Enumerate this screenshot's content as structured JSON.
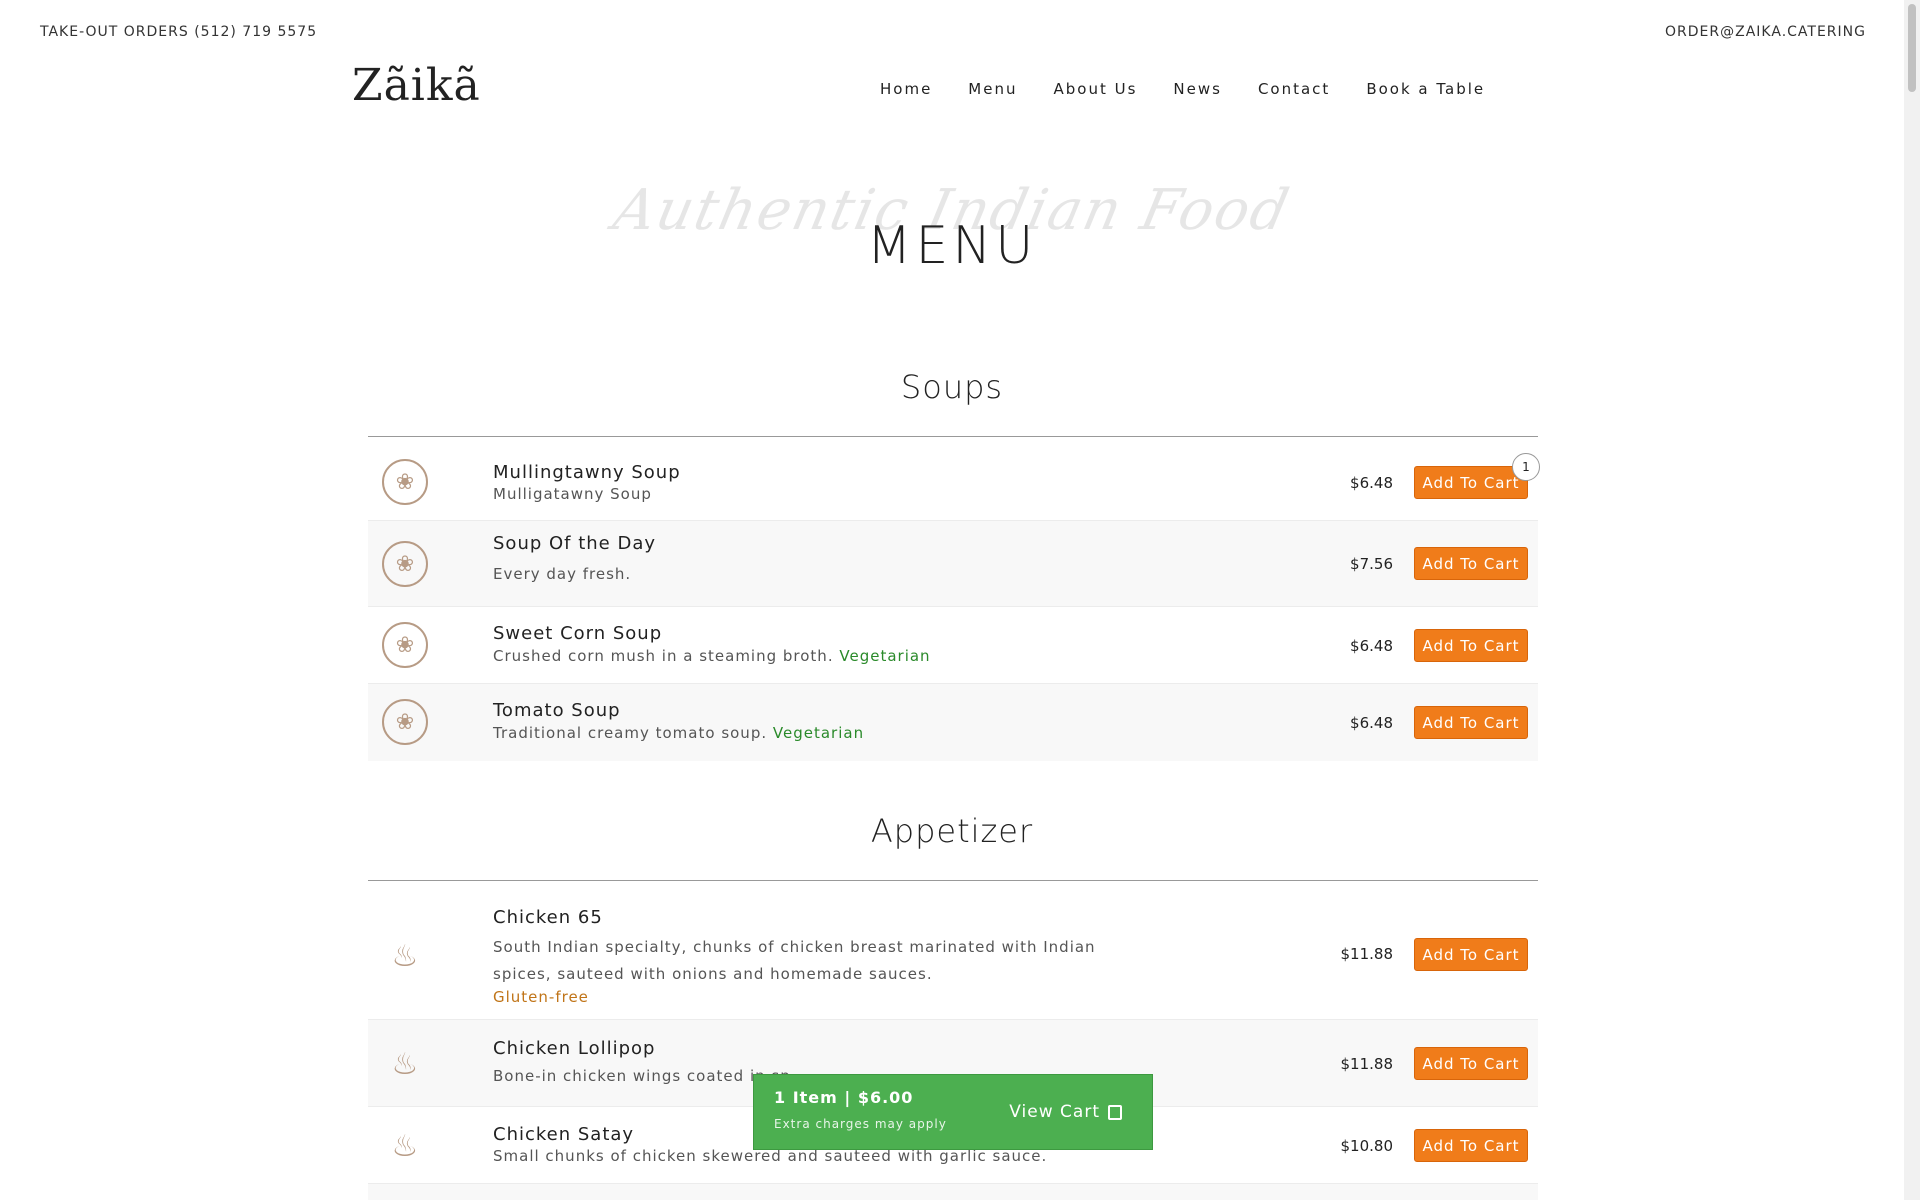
{
  "topbar": {
    "phone": "TAKE-OUT ORDERS (512) 719 5575",
    "email": "ORDER@ZAIKA.CATERING"
  },
  "logo": "Zãikã",
  "nav": {
    "home": "Home",
    "menu": "Menu",
    "about": "About Us",
    "news": "News",
    "contact": "Contact",
    "book": "Book a Table"
  },
  "hero": {
    "script": "Authentic Indian Food",
    "title": "MENU"
  },
  "sections": {
    "soups": {
      "title": "Soups",
      "items": [
        {
          "name": "Mullingtawny Soup",
          "desc": "Mulligatawny Soup",
          "tag": "",
          "price": "$6.48",
          "button": "Add To Cart",
          "qty": "1"
        },
        {
          "name": "Soup Of the Day",
          "desc": "Every day fresh.",
          "tag": "",
          "price": "$7.56",
          "button": "Add To Cart"
        },
        {
          "name": "Sweet Corn Soup",
          "desc": "Crushed corn mush in a steaming broth.",
          "tag": "Vegetarian",
          "price": "$6.48",
          "button": "Add To Cart"
        },
        {
          "name": "Tomato Soup",
          "desc": "Traditional creamy tomato soup.",
          "tag": "Vegetarian",
          "price": "$6.48",
          "button": "Add To Cart"
        }
      ]
    },
    "appetizer": {
      "title": "Appetizer",
      "items": [
        {
          "name": "Chicken 65",
          "desc": "South Indian specialty, chunks of chicken breast marinated with Indian spices, sauteed with onions and homemade sauces.",
          "tag": "Gluten-free",
          "price": "$11.88",
          "button": "Add To Cart"
        },
        {
          "name": "Chicken Lollipop",
          "desc": "Bone-in chicken wings coated in sp",
          "price": "$11.88",
          "button": "Add To Cart"
        },
        {
          "name": "Chicken Satay",
          "desc": "Small chunks of chicken skewered and sauteed with garlic sauce.",
          "price": "$10.80",
          "button": "Add To Cart"
        }
      ]
    }
  },
  "cart": {
    "summary": "1 Item  |  $6.00",
    "note": "Extra charges may apply",
    "view": "View Cart"
  },
  "icons": {
    "soup": "soup-bowl-icon",
    "appetizer": "roast-chicken-icon",
    "cart": "shopping-bag-icon"
  },
  "colors": {
    "accent": "#f07c1a",
    "cart": "#4caf50",
    "vegetarian": "#2a8a2a",
    "gluten_free": "#c07418",
    "icon": "#b79b85"
  }
}
